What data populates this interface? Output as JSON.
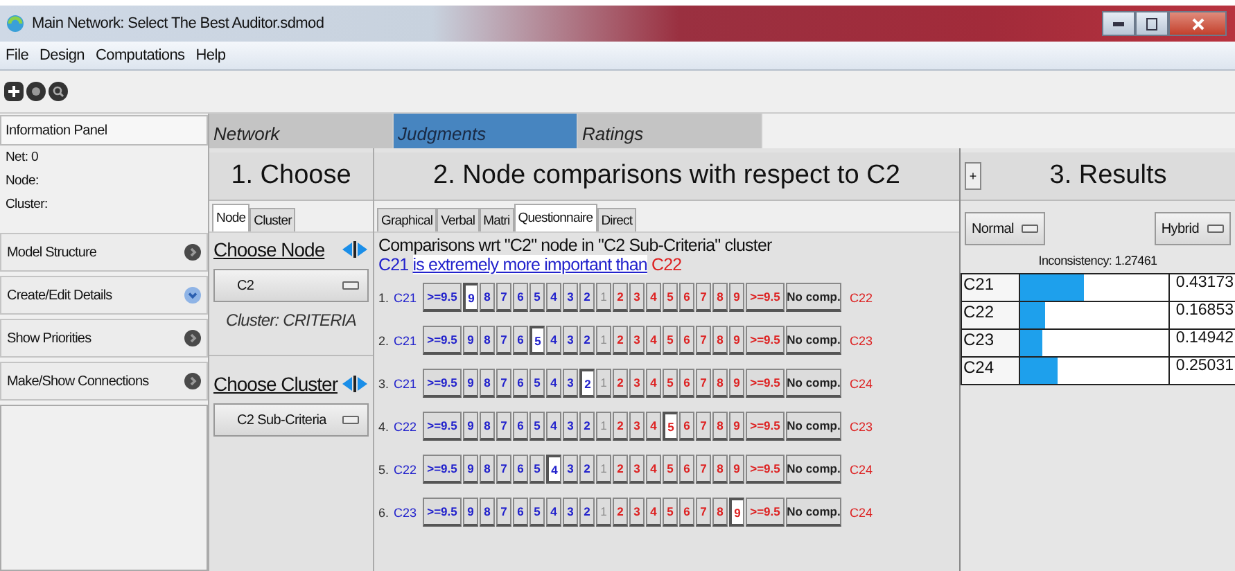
{
  "window": {
    "title": "Main Network: Select The Best Auditor.sdmod"
  },
  "menu": [
    "File",
    "Design",
    "Computations",
    "Help"
  ],
  "info_panel": {
    "title": "Information Panel",
    "lines": [
      "Net: 0",
      "Node:",
      "Cluster:"
    ]
  },
  "sidebar": {
    "items": [
      {
        "label": "Model Structure",
        "expanded": false
      },
      {
        "label": "Create/Edit Details",
        "expanded": true
      },
      {
        "label": "Show Priorities",
        "expanded": false
      },
      {
        "label": "Make/Show Connections",
        "expanded": false
      }
    ]
  },
  "main_tabs": [
    {
      "label": "Network",
      "selected": false
    },
    {
      "label": "Judgments",
      "selected": true
    },
    {
      "label": "Ratings",
      "selected": false
    }
  ],
  "choose": {
    "title": "1. Choose",
    "tabs": [
      {
        "label": "Node",
        "selected": true
      },
      {
        "label": "Cluster",
        "selected": false
      }
    ],
    "node_heading": "Choose Node",
    "node_value": "C2",
    "cluster_note": "Cluster: CRITERIA",
    "cluster_heading": "Choose Cluster",
    "cluster_value": "C2 Sub-Criteria"
  },
  "comparisons": {
    "title": "2. Node comparisons with respect to C2",
    "tabs": [
      {
        "label": "Graphical",
        "selected": false
      },
      {
        "label": "Verbal",
        "selected": false
      },
      {
        "label": "Matri",
        "selected": false
      },
      {
        "label": "Questionnaire",
        "selected": true
      },
      {
        "label": "Direct",
        "selected": false
      }
    ],
    "description": "Comparisons wrt \"C2\" node in \"C2 Sub-Criteria\" cluster",
    "verdict": {
      "left": "C21",
      "phrase": "is extremely more important than",
      "right": "C22"
    },
    "rows": [
      {
        "number": "1.",
        "left": "C21",
        "right": "C22",
        "buttons": [
          {
            "label": ">=9.5",
            "kind": "left",
            "selected": false
          },
          {
            "label": "9",
            "kind": "left",
            "selected": true
          },
          {
            "label": "8",
            "kind": "left",
            "selected": false
          },
          {
            "label": "7",
            "kind": "left",
            "selected": false
          },
          {
            "label": "6",
            "kind": "left",
            "selected": false
          },
          {
            "label": "5",
            "kind": "left",
            "selected": false
          },
          {
            "label": "4",
            "kind": "left",
            "selected": false
          },
          {
            "label": "3",
            "kind": "left",
            "selected": false
          },
          {
            "label": "2",
            "kind": "left",
            "selected": false
          },
          {
            "label": "1",
            "kind": "center",
            "selected": false
          },
          {
            "label": "2",
            "kind": "right",
            "selected": false
          },
          {
            "label": "3",
            "kind": "right",
            "selected": false
          },
          {
            "label": "4",
            "kind": "right",
            "selected": false
          },
          {
            "label": "5",
            "kind": "right",
            "selected": false
          },
          {
            "label": "6",
            "kind": "right",
            "selected": false
          },
          {
            "label": "7",
            "kind": "right",
            "selected": false
          },
          {
            "label": "8",
            "kind": "right",
            "selected": false
          },
          {
            "label": "9",
            "kind": "right",
            "selected": false
          },
          {
            "label": ">=9.5",
            "kind": "right",
            "selected": false
          },
          {
            "label": "No comp.",
            "kind": "none",
            "selected": false
          }
        ]
      },
      {
        "number": "2.",
        "left": "C21",
        "right": "C23",
        "buttons": [
          {
            "label": ">=9.5",
            "kind": "left",
            "selected": false
          },
          {
            "label": "9",
            "kind": "left",
            "selected": false
          },
          {
            "label": "8",
            "kind": "left",
            "selected": false
          },
          {
            "label": "7",
            "kind": "left",
            "selected": false
          },
          {
            "label": "6",
            "kind": "left",
            "selected": false
          },
          {
            "label": "5",
            "kind": "left",
            "selected": true
          },
          {
            "label": "4",
            "kind": "left",
            "selected": false
          },
          {
            "label": "3",
            "kind": "left",
            "selected": false
          },
          {
            "label": "2",
            "kind": "left",
            "selected": false
          },
          {
            "label": "1",
            "kind": "center",
            "selected": false
          },
          {
            "label": "2",
            "kind": "right",
            "selected": false
          },
          {
            "label": "3",
            "kind": "right",
            "selected": false
          },
          {
            "label": "4",
            "kind": "right",
            "selected": false
          },
          {
            "label": "5",
            "kind": "right",
            "selected": false
          },
          {
            "label": "6",
            "kind": "right",
            "selected": false
          },
          {
            "label": "7",
            "kind": "right",
            "selected": false
          },
          {
            "label": "8",
            "kind": "right",
            "selected": false
          },
          {
            "label": "9",
            "kind": "right",
            "selected": false
          },
          {
            "label": ">=9.5",
            "kind": "right",
            "selected": false
          },
          {
            "label": "No comp.",
            "kind": "none",
            "selected": false
          }
        ]
      },
      {
        "number": "3.",
        "left": "C21",
        "right": "C24",
        "buttons": [
          {
            "label": ">=9.5",
            "kind": "left",
            "selected": false
          },
          {
            "label": "9",
            "kind": "left",
            "selected": false
          },
          {
            "label": "8",
            "kind": "left",
            "selected": false
          },
          {
            "label": "7",
            "kind": "left",
            "selected": false
          },
          {
            "label": "6",
            "kind": "left",
            "selected": false
          },
          {
            "label": "5",
            "kind": "left",
            "selected": false
          },
          {
            "label": "4",
            "kind": "left",
            "selected": false
          },
          {
            "label": "3",
            "kind": "left",
            "selected": false
          },
          {
            "label": "2",
            "kind": "left",
            "selected": true
          },
          {
            "label": "1",
            "kind": "center",
            "selected": false
          },
          {
            "label": "2",
            "kind": "right",
            "selected": false
          },
          {
            "label": "3",
            "kind": "right",
            "selected": false
          },
          {
            "label": "4",
            "kind": "right",
            "selected": false
          },
          {
            "label": "5",
            "kind": "right",
            "selected": false
          },
          {
            "label": "6",
            "kind": "right",
            "selected": false
          },
          {
            "label": "7",
            "kind": "right",
            "selected": false
          },
          {
            "label": "8",
            "kind": "right",
            "selected": false
          },
          {
            "label": "9",
            "kind": "right",
            "selected": false
          },
          {
            "label": ">=9.5",
            "kind": "right",
            "selected": false
          },
          {
            "label": "No comp.",
            "kind": "none",
            "selected": false
          }
        ]
      },
      {
        "number": "4.",
        "left": "C22",
        "right": "C23",
        "buttons": [
          {
            "label": ">=9.5",
            "kind": "left",
            "selected": false
          },
          {
            "label": "9",
            "kind": "left",
            "selected": false
          },
          {
            "label": "8",
            "kind": "left",
            "selected": false
          },
          {
            "label": "7",
            "kind": "left",
            "selected": false
          },
          {
            "label": "6",
            "kind": "left",
            "selected": false
          },
          {
            "label": "5",
            "kind": "left",
            "selected": false
          },
          {
            "label": "4",
            "kind": "left",
            "selected": false
          },
          {
            "label": "3",
            "kind": "left",
            "selected": false
          },
          {
            "label": "2",
            "kind": "left",
            "selected": false
          },
          {
            "label": "1",
            "kind": "center",
            "selected": false
          },
          {
            "label": "2",
            "kind": "right",
            "selected": false
          },
          {
            "label": "3",
            "kind": "right",
            "selected": false
          },
          {
            "label": "4",
            "kind": "right",
            "selected": false
          },
          {
            "label": "5",
            "kind": "right",
            "selected": true
          },
          {
            "label": "6",
            "kind": "right",
            "selected": false
          },
          {
            "label": "7",
            "kind": "right",
            "selected": false
          },
          {
            "label": "8",
            "kind": "right",
            "selected": false
          },
          {
            "label": "9",
            "kind": "right",
            "selected": false
          },
          {
            "label": ">=9.5",
            "kind": "right",
            "selected": false
          },
          {
            "label": "No comp.",
            "kind": "none",
            "selected": false
          }
        ]
      },
      {
        "number": "5.",
        "left": "C22",
        "right": "C24",
        "buttons": [
          {
            "label": ">=9.5",
            "kind": "left",
            "selected": false
          },
          {
            "label": "9",
            "kind": "left",
            "selected": false
          },
          {
            "label": "8",
            "kind": "left",
            "selected": false
          },
          {
            "label": "7",
            "kind": "left",
            "selected": false
          },
          {
            "label": "6",
            "kind": "left",
            "selected": false
          },
          {
            "label": "5",
            "kind": "left",
            "selected": false
          },
          {
            "label": "4",
            "kind": "left",
            "selected": true
          },
          {
            "label": "3",
            "kind": "left",
            "selected": false
          },
          {
            "label": "2",
            "kind": "left",
            "selected": false
          },
          {
            "label": "1",
            "kind": "center",
            "selected": false
          },
          {
            "label": "2",
            "kind": "right",
            "selected": false
          },
          {
            "label": "3",
            "kind": "right",
            "selected": false
          },
          {
            "label": "4",
            "kind": "right",
            "selected": false
          },
          {
            "label": "5",
            "kind": "right",
            "selected": false
          },
          {
            "label": "6",
            "kind": "right",
            "selected": false
          },
          {
            "label": "7",
            "kind": "right",
            "selected": false
          },
          {
            "label": "8",
            "kind": "right",
            "selected": false
          },
          {
            "label": "9",
            "kind": "right",
            "selected": false
          },
          {
            "label": ">=9.5",
            "kind": "right",
            "selected": false
          },
          {
            "label": "No comp.",
            "kind": "none",
            "selected": false
          }
        ]
      },
      {
        "number": "6.",
        "left": "C23",
        "right": "C24",
        "buttons": [
          {
            "label": ">=9.5",
            "kind": "left",
            "selected": false
          },
          {
            "label": "9",
            "kind": "left",
            "selected": false
          },
          {
            "label": "8",
            "kind": "left",
            "selected": false
          },
          {
            "label": "7",
            "kind": "left",
            "selected": false
          },
          {
            "label": "6",
            "kind": "left",
            "selected": false
          },
          {
            "label": "5",
            "kind": "left",
            "selected": false
          },
          {
            "label": "4",
            "kind": "left",
            "selected": false
          },
          {
            "label": "3",
            "kind": "left",
            "selected": false
          },
          {
            "label": "2",
            "kind": "left",
            "selected": false
          },
          {
            "label": "1",
            "kind": "center",
            "selected": false
          },
          {
            "label": "2",
            "kind": "right",
            "selected": false
          },
          {
            "label": "3",
            "kind": "right",
            "selected": false
          },
          {
            "label": "4",
            "kind": "right",
            "selected": false
          },
          {
            "label": "5",
            "kind": "right",
            "selected": false
          },
          {
            "label": "6",
            "kind": "right",
            "selected": false
          },
          {
            "label": "7",
            "kind": "right",
            "selected": false
          },
          {
            "label": "8",
            "kind": "right",
            "selected": false
          },
          {
            "label": "9",
            "kind": "right",
            "selected": true
          },
          {
            "label": ">=9.5",
            "kind": "right",
            "selected": false
          },
          {
            "label": "No comp.",
            "kind": "none",
            "selected": false
          }
        ]
      }
    ]
  },
  "results": {
    "expand_button": "+",
    "title": "3. Results",
    "mode": "Normal",
    "method": "Hybrid",
    "inconsistency": "Inconsistency: 1.27461",
    "items": [
      {
        "name": "C21",
        "level": 0.43,
        "value": "0.43173"
      },
      {
        "name": "C22",
        "level": 0.17,
        "value": "0.16853"
      },
      {
        "name": "C23",
        "level": 0.15,
        "value": "0.14942"
      },
      {
        "name": "C24",
        "level": 0.25,
        "value": "0.25031"
      }
    ]
  }
}
